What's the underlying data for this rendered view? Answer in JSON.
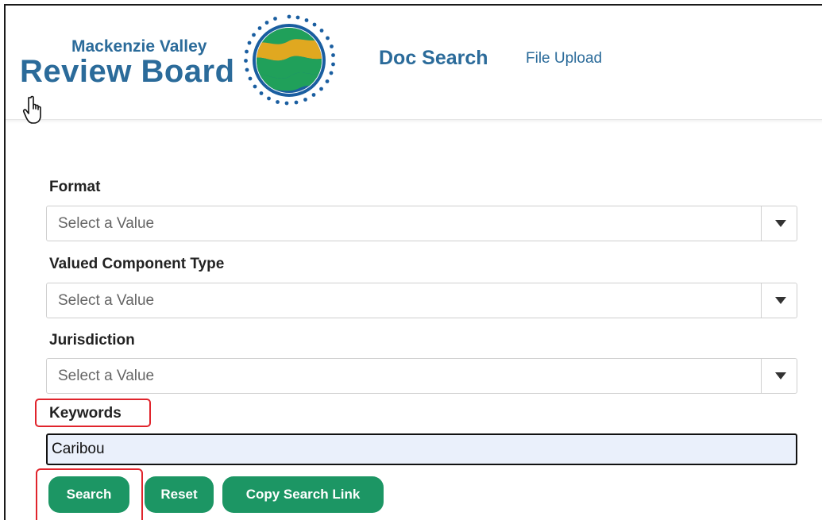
{
  "header": {
    "logo_line1": "Mackenzie Valley",
    "logo_line2": "Review Board",
    "nav": {
      "doc_search": "Doc Search",
      "file_upload": "File Upload"
    }
  },
  "form": {
    "format": {
      "label": "Format",
      "placeholder": "Select a Value"
    },
    "valued_component_type": {
      "label": "Valued Component Type",
      "placeholder": "Select a Value"
    },
    "jurisdiction": {
      "label": "Jurisdiction",
      "placeholder": "Select a Value"
    },
    "keywords": {
      "label": "Keywords",
      "value": "Caribou"
    }
  },
  "buttons": {
    "search": "Search",
    "reset": "Reset",
    "copy_link": "Copy Search Link"
  },
  "colors": {
    "brand_blue": "#2b6b9a",
    "button_green": "#1c9664",
    "highlight_red": "#e0242c",
    "emblem_green": "#20a05a",
    "emblem_gold": "#e0a820",
    "emblem_blue": "#1a5ea0"
  },
  "icons": [
    "hand-pointer-cursor-icon",
    "chevron-down-icon"
  ]
}
